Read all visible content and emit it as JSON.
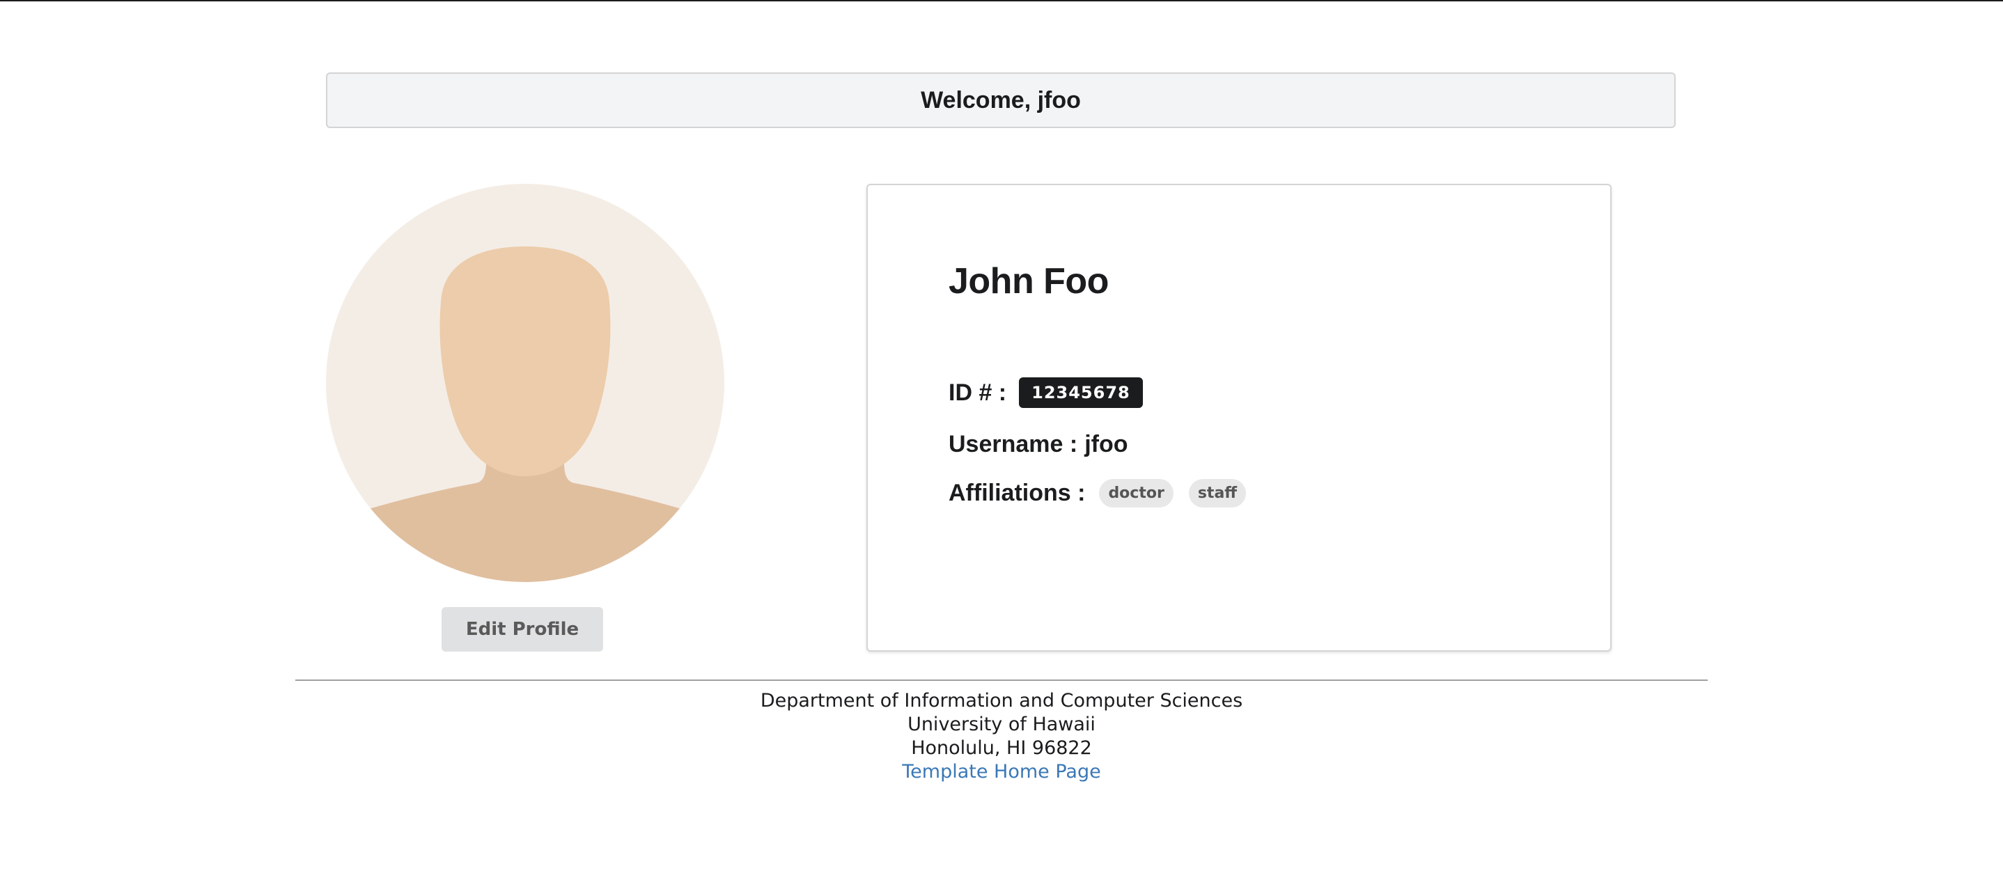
{
  "header": {
    "welcome": "Welcome, jfoo"
  },
  "profile": {
    "avatar_icon": "user-silhouette-icon",
    "edit_button_label": "Edit Profile",
    "name": "John Foo",
    "id_label": "ID # :",
    "id_value": "12345678",
    "username_label": "Username :",
    "username_value": "jfoo",
    "affiliations_label": "Affiliations :",
    "affiliations": [
      "doctor",
      "staff"
    ]
  },
  "footer": {
    "line1": "Department of Information and Computer Sciences",
    "line2": "University of Hawaii",
    "line3": "Honolulu, HI 96822",
    "link_label": "Template Home Page"
  },
  "colors": {
    "badge_dark": "#1b1c1d",
    "link_blue": "#3b78b6",
    "welcome_bg": "#f3f4f5",
    "avatar_bg": "#f4ede6",
    "skin_face": "#ecccaa",
    "skin_body": "#e0bf9f"
  }
}
